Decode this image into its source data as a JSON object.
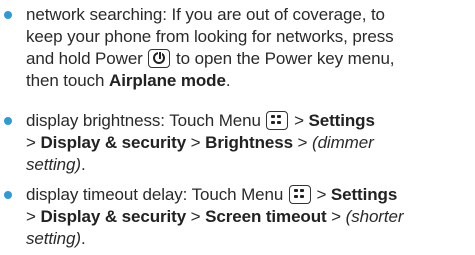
{
  "tips": [
    {
      "lines": {
        "l1": "network searching: If you are out of coverage, to",
        "l2": "keep your phone from looking for networks, press",
        "l3a": "and hold Power ",
        "l3b": " to open the Power key menu,",
        "l4a": "then touch ",
        "l4b": "Airplane mode",
        "l4c": "."
      },
      "key_icon": "power-icon"
    },
    {
      "lines": {
        "l1a": "display brightness: Touch Menu ",
        "l1b": " > ",
        "l1c": "Settings",
        "l2a": "> ",
        "l2b": "Display & security",
        "l2c": " > ",
        "l2d": "Brightness",
        "l2e": " > ",
        "l2f": "(dimmer",
        "l3": "setting)",
        "l3b": "."
      },
      "key_icon": "menu-icon"
    },
    {
      "lines": {
        "l1a": "display timeout delay: Touch Menu ",
        "l1b": " > ",
        "l1c": "Settings",
        "l2a": "> ",
        "l2b": "Display & security",
        "l2c": " > ",
        "l2d": "Screen timeout",
        "l2e": " > ",
        "l2f": "(shorter",
        "l3": "setting)",
        "l3b": "."
      },
      "key_icon": "menu-icon"
    }
  ],
  "colors": {
    "bullet": "#2f9bd6",
    "text": "#2a2a2a"
  }
}
